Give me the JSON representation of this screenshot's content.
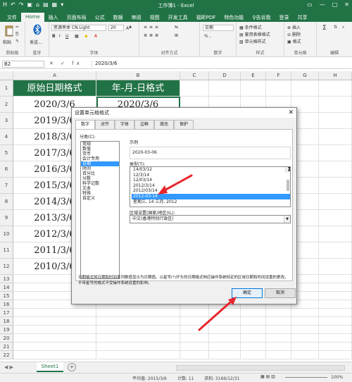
{
  "window": {
    "title": "工作簿1 - Excel",
    "quick_access": [
      "H",
      "↶",
      "↷",
      "▣",
      "⌂",
      "▤",
      "▦",
      "▾"
    ],
    "controls": [
      "▭",
      "—",
      "□",
      "✕"
    ]
  },
  "tabs": [
    "文件",
    "Home",
    "插入",
    "页面布局",
    "公式",
    "数据",
    "审阅",
    "视图",
    "开发工具",
    "福昕PDF",
    "特色功能",
    "♀告诉我",
    "登录",
    "共享"
  ],
  "ribbon": {
    "clipboard": {
      "paste": "粘贴",
      "label": "剪贴板"
    },
    "bluetooth": {
      "send": "发送...",
      "label": "蓝牙"
    },
    "font": {
      "name": "思源黑体 CN Light",
      "size": "20",
      "label": "字体",
      "bold": "B",
      "italic": "I",
      "underline": "U"
    },
    "alignment": {
      "label": "对齐方式"
    },
    "number": {
      "format": "日期",
      "label": "数字",
      "symbols": "% ,"
    },
    "styles": {
      "conditional": "条件格式",
      "table": "套用表格格式",
      "cell": "单元格样式",
      "label": "样式"
    },
    "cells": {
      "insert": "插入",
      "delete": "删除",
      "format": "格式",
      "label": "单元格"
    },
    "editing": {
      "label": "编辑"
    }
  },
  "formula_bar": {
    "name_box": "B2",
    "fx": "✕ ✓ fx",
    "content": "2020/3/6"
  },
  "grid": {
    "columns": [
      "A",
      "B",
      "C",
      "D",
      "E",
      "F",
      "G",
      "H"
    ],
    "rows": [
      "1",
      "2",
      "3",
      "4",
      "5",
      "6",
      "7",
      "8",
      "9",
      "10",
      "11",
      "12",
      "13",
      "14",
      "15",
      "16",
      "17",
      "18",
      "19",
      "20",
      "21",
      "22"
    ],
    "header_a": "原始日期格式",
    "header_b": "年-月-日格式",
    "col_a": [
      "2020/3/6",
      "2019/3/6",
      "2018/3/6",
      "2017/3/6",
      "2016/3/6",
      "2015/3/6",
      "2014/3/6",
      "2013/3/6",
      "2012/3/6",
      "2011/3/6",
      "2010/3/6"
    ],
    "col_b": [
      "2020/3/6"
    ]
  },
  "sheetbar": {
    "sheet": "Sheet1",
    "add": "+"
  },
  "statusbar": {
    "average": "平均值: 2015/3/6",
    "count": "计数: 11",
    "sum": "求和: 3166/12/31",
    "zoom": "100%"
  },
  "dialog": {
    "title": "设置单元格格式",
    "close": "✕",
    "tabs": [
      "数字",
      "对齐",
      "字体",
      "边框",
      "填充",
      "保护"
    ],
    "category_label": "分类(C):",
    "categories": [
      "常规",
      "数值",
      "货币",
      "会计专用",
      "日期",
      "时间",
      "百分比",
      "分数",
      "科学记数",
      "文本",
      "特殊",
      "自定义"
    ],
    "selected_category": 4,
    "sample_label": "示例",
    "sample_value": "2020-03-06",
    "type_label": "类型(T):",
    "types": [
      "14/03/12",
      "12/3/14",
      "12/03/14",
      "2012/3/14",
      "2012/03/14",
      "2012-03-14",
      "星期三, 14 三月, 2012"
    ],
    "selected_type": 5,
    "locale_label": "区域设置(国家/地区)(L):",
    "locale_value": "中文(香港特别行政区)",
    "description": "日期格式将日期和时间系列数值显示为日期值。以星号(*)开头的日期格式响应操作系统特定的区域日期和时间设置的更改。不带星号的格式不受操作系统设置的影响。",
    "ok": "确定",
    "cancel": "取消"
  },
  "colors": {
    "excel_green": "#217346",
    "selection_blue": "#3399ff",
    "arrow_red": "#e8262c"
  }
}
